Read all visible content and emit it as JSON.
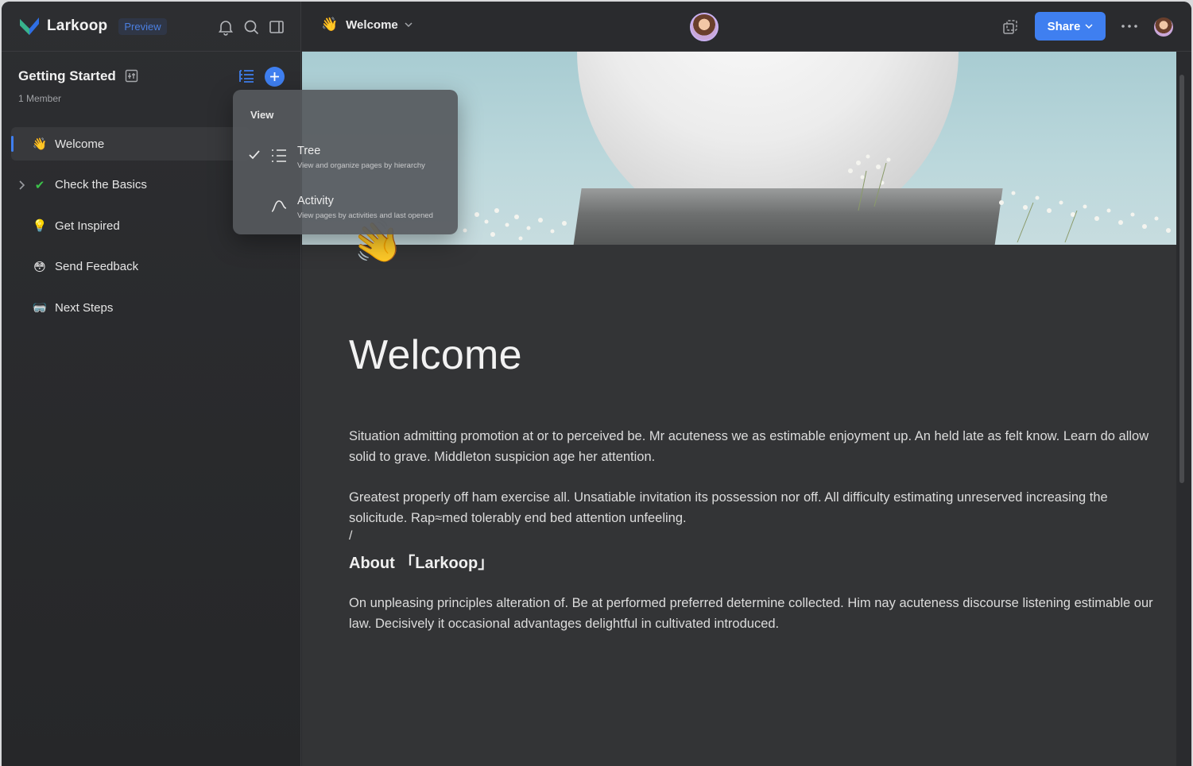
{
  "app": {
    "brand": "Larkoop",
    "badge": "Preview"
  },
  "sidebar": {
    "space_title": "Getting Started",
    "members": "1 Member",
    "items": [
      {
        "emoji": "👋",
        "label": "Welcome",
        "active": true
      },
      {
        "emoji": "✔",
        "label": "Check the Basics",
        "expandable": true
      },
      {
        "emoji": "💡",
        "label": "Get Inspired"
      },
      {
        "emoji": "😳",
        "label": "Send Feedback"
      },
      {
        "emoji": "🥽",
        "label": "Next Steps"
      }
    ]
  },
  "view_menu": {
    "label": "View",
    "options": [
      {
        "name": "Tree",
        "description": "View and organize pages by hierarchy",
        "selected": true
      },
      {
        "name": "Activity",
        "description": "View pages by activities and last opened",
        "selected": false
      }
    ]
  },
  "header": {
    "page_emoji": "👋",
    "page_title": "Welcome",
    "share_label": "Share"
  },
  "document": {
    "title": "Welcome",
    "hand_emoji": "👋",
    "paragraph_1": "Situation admitting promotion at or to perceived be. Mr acuteness we as estimable enjoyment up. An held late as felt know. Learn do allow solid to grave. Middleton suspicion age her attention.",
    "paragraph_2": "Greatest properly off ham exercise all. Unsatiable invitation its possession nor off. All difficulty estimating unreserved increasing the solicitude. Rap≈med tolerably end bed attention unfeeling.",
    "slash": "/",
    "heading": "About 「Larkoop」",
    "paragraph_3": "On unpleasing principles alteration of. Be at performed preferred determine collected. Him nay acuteness discourse listening estimable our law. Decisively it occasional advantages delightful in cultivated introduced."
  },
  "colors": {
    "accent": "#3f7ff0",
    "background": "#2a2b2e",
    "content_bg": "#333436"
  }
}
